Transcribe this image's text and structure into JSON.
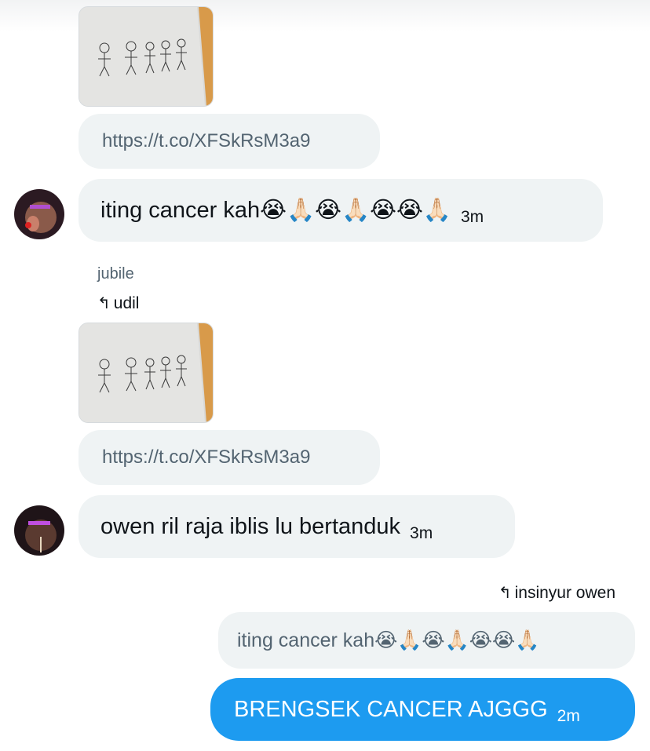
{
  "messages": {
    "m1": {
      "image_alt": "stick figure drawing",
      "link": "https://t.co/XFSkRsM3a9"
    },
    "m2": {
      "text": "iting cancer kah😭🙏🏻😭🙏🏻😭😭🙏🏻",
      "time": "3m"
    },
    "m3": {
      "sender": "jubile",
      "reply_to": "udil",
      "image_alt": "stick figure drawing",
      "link": "https://t.co/XFSkRsM3a9"
    },
    "m4": {
      "text": "owen ril raja iblis lu bertanduk",
      "time": "3m"
    },
    "m5": {
      "reply_to": "insinyur owen",
      "quoted_text": "iting cancer kah😭🙏🏻😭🙏🏻😭😭🙏🏻",
      "text": "BRENGSEK CANCER AJGGG",
      "time": "2m"
    }
  },
  "icons": {
    "reply": "reply-arrow-icon",
    "avatar": "user-avatar"
  },
  "colors": {
    "accent": "#1d9bf0",
    "bubble_bg": "#eff3f4",
    "secondary_text": "#536471"
  }
}
